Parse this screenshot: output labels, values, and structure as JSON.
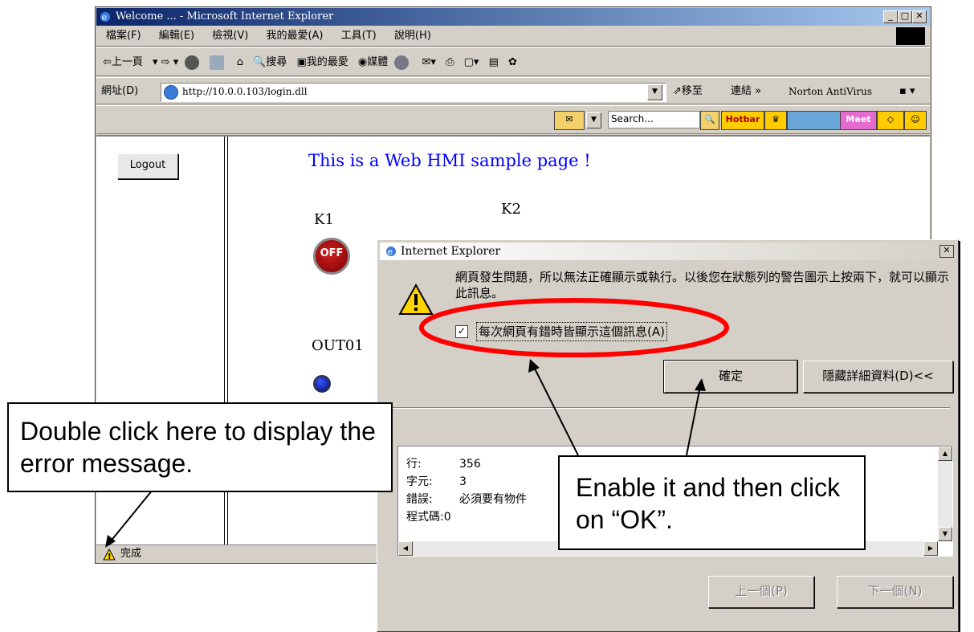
{
  "browser": {
    "title": "Welcome ... - Microsoft Internet Explorer",
    "menu": [
      "檔案(F)",
      "編輯(E)",
      "檢視(V)",
      "我的最愛(A)",
      "工具(T)",
      "說明(H)"
    ],
    "toolbar": {
      "back": "⇦上一頁",
      "search": "搜尋",
      "favorites": "我的最愛",
      "media": "媒體"
    },
    "address": {
      "label": "網址(D)",
      "url": "http://10.0.0.103/login.dll",
      "go": "移至",
      "links": "連結",
      "extra": "Norton AntiVirus"
    },
    "search_toolbar": {
      "placeholder": "Search...",
      "hotbar": "Hotbar",
      "meet": "Meet"
    },
    "status_text": "完成"
  },
  "page": {
    "logout_label": "Logout",
    "headline": "This is a Web HMI sample page !",
    "k1_label": "K1",
    "k2_label": "K2",
    "k1_button": "OFF",
    "out01_label": "OUT01"
  },
  "dialog": {
    "title": "Internet Explorer",
    "message": "網頁發生問題，所以無法正確顯示或執行。以後您在狀態列的警告圖示上按兩下，就可以顯示此訊息。",
    "checkbox_label": "每次網頁有錯時皆顯示這個訊息(A)",
    "checkbox_checked": true,
    "ok_label": "確定",
    "details_label": "隱藏詳細資料(D)<<",
    "prev_label": "上一個(P)",
    "next_label": "下一個(N)",
    "details": [
      {
        "key": "行:",
        "value": "356"
      },
      {
        "key": "字元:",
        "value": "3"
      },
      {
        "key": "錯誤:",
        "value": "必須要有物件"
      },
      {
        "key": "程式碼:0",
        "value": ""
      }
    ]
  },
  "annotations": {
    "left": "Double click here to display the error message.",
    "right": "Enable it and then click on “OK”."
  },
  "colors": {
    "headline": "#0000ff",
    "highlight_ellipse": "#ff0000"
  }
}
